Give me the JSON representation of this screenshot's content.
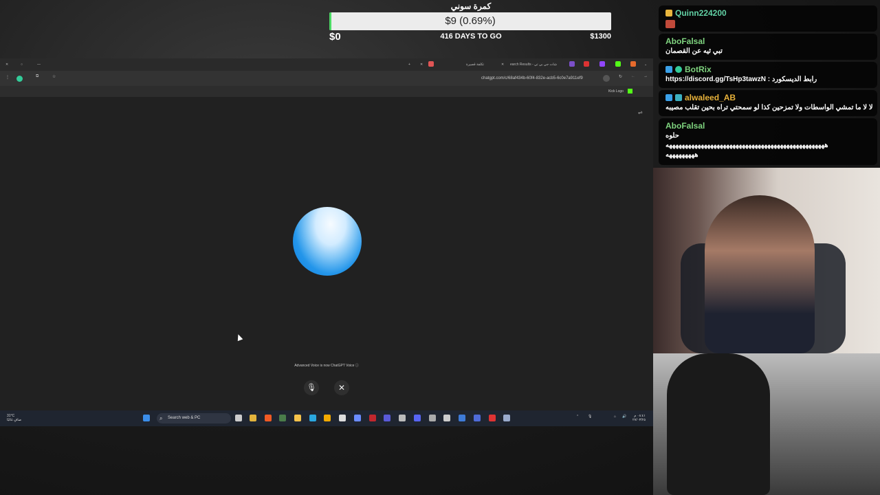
{
  "goal": {
    "title": "كمرة سوني",
    "amount": "$9 (0.69%)",
    "start": "$0",
    "days_left": "416 DAYS TO GO",
    "target": "$1300",
    "progress_fraction": 0.0069,
    "fill_color": "#4cd964"
  },
  "browser": {
    "tabs": [
      {
        "label": "تكلفة قصيرة",
        "icon_color": "#e05555"
      },
      {
        "label": "earch Results - شات جي بي تي",
        "icon_color": "#888"
      }
    ],
    "url": "chatgpt.com/c/68af434b-60f4-832e-acb5-6c0e7a911ef9",
    "bookmark": "Kick Logo",
    "kick_color": "#53fc18"
  },
  "voice": {
    "note": "Advanced Voice is now ChatGPT Voice ⓘ",
    "mic_icon": "🎙",
    "close_icon": "✕",
    "orb_color": "#1e8fe8"
  },
  "taskbar": {
    "weather_temp": "31°C",
    "weather_desc": "صافٍ غالبًا",
    "search_placeholder": "Search web & PC",
    "clock_time": "٠٨:٤١ م",
    "clock_date": "٢٧/٠٣/٢٥"
  },
  "chat": {
    "messages": [
      {
        "user": "Quinn224200",
        "color": "#62d1a5",
        "badge": "#e8b53d",
        "text": "",
        "emote": true
      },
      {
        "user": "AboFalsal",
        "color": "#7fd47f",
        "badge": "",
        "text": "تبي ثيه عن القصمان",
        "emote": false
      },
      {
        "user": "BotRix",
        "color": "#7fd47f",
        "badge": "#3aa0e8",
        "text": "https://discord.gg/TsHp3tawzN : رابط الديسكورد",
        "emote": false
      },
      {
        "user": "alwaleed_AB",
        "color": "#e8b23a",
        "badge": "#3aa0e8",
        "text": "لا لا ما تمشي الواسطات ولا تمزحين كذا لو سمحتي تراه بحين تقلب مصيبه",
        "emote": false
      },
      {
        "user": "AboFalsal",
        "color": "#7fd47f",
        "badge": "",
        "text": "حلوه",
        "text2": "ههههههههههههههههههههههههههههههههههههههههههههههههههه",
        "text3": "هههههههههه",
        "emote": false
      }
    ]
  }
}
